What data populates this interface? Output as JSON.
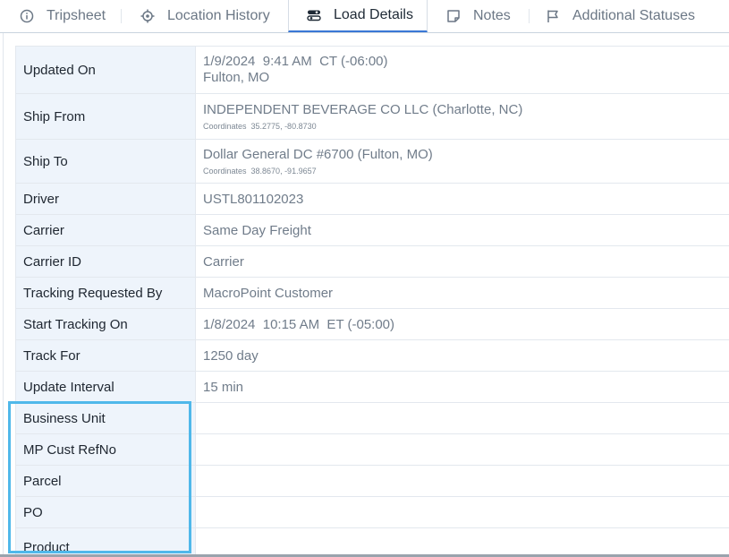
{
  "tabs": [
    {
      "label": "Tripsheet",
      "icon": "info-circle-icon"
    },
    {
      "label": "Location History",
      "icon": "crosshair-icon"
    },
    {
      "label": "Load Details",
      "icon": "toggles-icon",
      "active": true
    },
    {
      "label": "Notes",
      "icon": "sticky-note-icon"
    },
    {
      "label": "Additional Statuses",
      "icon": "flag-icon"
    }
  ],
  "details": {
    "updated_on": {
      "label": "Updated On",
      "value": "1/9/2024  9:41 AM  CT (-06:00)",
      "value2": "Fulton, MO"
    },
    "ship_from": {
      "label": "Ship From",
      "value": "INDEPENDENT BEVERAGE CO LLC (Charlotte, NC)",
      "coords": "Coordinates  35.2775, -80.8730"
    },
    "ship_to": {
      "label": "Ship To",
      "value": "Dollar General DC #6700 (Fulton, MO)",
      "coords": "Coordinates  38.8670, -91.9657"
    },
    "driver": {
      "label": "Driver",
      "value": "USTL801102023"
    },
    "carrier": {
      "label": "Carrier",
      "value": "Same Day Freight"
    },
    "carrier_id": {
      "label": "Carrier ID",
      "value": "Carrier"
    },
    "tracking_requested_by": {
      "label": "Tracking Requested By",
      "value": "MacroPoint Customer"
    },
    "start_tracking_on": {
      "label": "Start Tracking On",
      "value": "1/8/2024  10:15 AM  ET (-05:00)"
    },
    "track_for": {
      "label": "Track For",
      "value": "1250 day"
    },
    "update_interval": {
      "label": "Update Interval",
      "value": "15 min"
    },
    "business_unit": {
      "label": "Business Unit",
      "value": ""
    },
    "mp_cust_refno": {
      "label": "MP Cust RefNo",
      "value": ""
    },
    "parcel": {
      "label": "Parcel",
      "value": ""
    },
    "po": {
      "label": "PO",
      "value": ""
    },
    "product": {
      "label": "Product",
      "value": ""
    }
  },
  "colors": {
    "label_bg": "#eef4fb",
    "active_tab_underline": "#3a78d6",
    "highlight_border": "#4fb8ea",
    "value_text": "#707c8a"
  }
}
